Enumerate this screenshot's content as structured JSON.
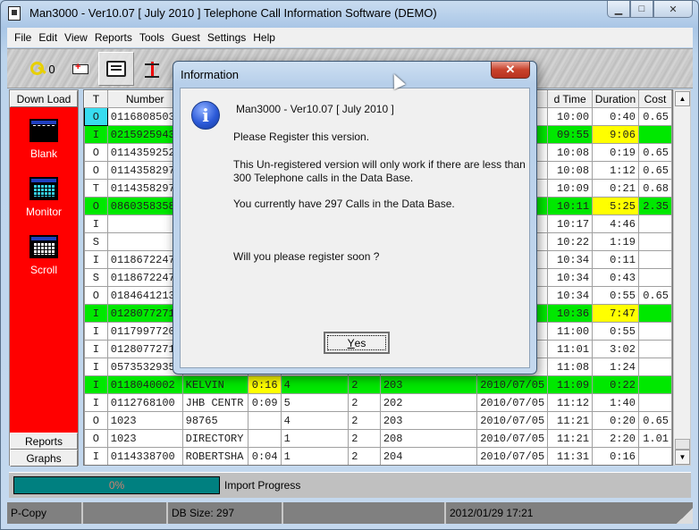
{
  "window": {
    "title": "Man3000  -  Ver10.07 [ July 2010 ]   Telephone Call Information Software (DEMO)",
    "controls": {
      "minimize": "▁",
      "maximize": "□",
      "close": "✕"
    }
  },
  "menu": [
    "File",
    "Edit",
    "View",
    "Reports",
    "Tools",
    "Guest",
    "Settings",
    "Help"
  ],
  "toolbar": {
    "key_count": "0",
    "buttons": [
      "key-icon",
      "ambulance-icon",
      "printer-icon",
      "network-icon"
    ]
  },
  "left_panel": {
    "download_label": "Down Load",
    "tools": [
      {
        "label": "Blank",
        "icon": "blank-grid-icon"
      },
      {
        "label": "Monitor",
        "icon": "monitor-grid-icon"
      },
      {
        "label": "Scroll",
        "icon": "scroll-grid-icon"
      }
    ],
    "reports_label": "Reports",
    "graphs_label": "Graphs"
  },
  "table": {
    "headers": [
      "T",
      "Number",
      "",
      "",
      "",
      "",
      "",
      "",
      "d Time",
      "Duration",
      "Cost"
    ],
    "rows": [
      {
        "t": "O",
        "number": "0116808503",
        "name": "",
        "dur": "",
        "c4": "",
        "c5": "",
        "ext": "",
        "date": "",
        "time": "10:00",
        "duration": "0:40",
        "cost": "0.65",
        "green": false,
        "t_cyan": true
      },
      {
        "t": "I",
        "number": "0215925943",
        "name": "",
        "dur": "",
        "c4": "",
        "c5": "",
        "ext": "",
        "date": "",
        "time": "09:55",
        "duration": "9:06",
        "cost": "",
        "green": true,
        "dur_yellow": true
      },
      {
        "t": "O",
        "number": "0114359252",
        "name": "",
        "dur": "",
        "c4": "",
        "c5": "",
        "ext": "",
        "date": "",
        "time": "10:08",
        "duration": "0:19",
        "cost": "0.65",
        "green": false
      },
      {
        "t": "O",
        "number": "0114358297",
        "name": "",
        "dur": "",
        "c4": "",
        "c5": "",
        "ext": "",
        "date": "",
        "time": "10:08",
        "duration": "1:12",
        "cost": "0.65",
        "green": false
      },
      {
        "t": "T",
        "number": "0114358297",
        "name": "",
        "dur": "",
        "c4": "",
        "c5": "",
        "ext": "",
        "date": "",
        "time": "10:09",
        "duration": "0:21",
        "cost": "0.68",
        "green": false
      },
      {
        "t": "O",
        "number": "0860358358",
        "name": "",
        "dur": "",
        "c4": "",
        "c5": "",
        "ext": "",
        "date": "",
        "time": "10:11",
        "duration": "5:25",
        "cost": "2.35",
        "green": true,
        "dur_yellow": true
      },
      {
        "t": "I",
        "number": "",
        "name": "",
        "dur": "",
        "c4": "",
        "c5": "",
        "ext": "",
        "date": "",
        "time": "10:17",
        "duration": "4:46",
        "cost": "",
        "green": false
      },
      {
        "t": "S",
        "number": "",
        "name": "",
        "dur": "",
        "c4": "",
        "c5": "",
        "ext": "",
        "date": "",
        "time": "10:22",
        "duration": "1:19",
        "cost": "",
        "green": false
      },
      {
        "t": "I",
        "number": "0118672247",
        "name": "",
        "dur": "",
        "c4": "",
        "c5": "",
        "ext": "",
        "date": "",
        "time": "10:34",
        "duration": "0:11",
        "cost": "",
        "green": false
      },
      {
        "t": "S",
        "number": "0118672247",
        "name": "",
        "dur": "",
        "c4": "",
        "c5": "",
        "ext": "",
        "date": "",
        "time": "10:34",
        "duration": "0:43",
        "cost": "",
        "green": false
      },
      {
        "t": "O",
        "number": "0184641213",
        "name": "",
        "dur": "",
        "c4": "",
        "c5": "",
        "ext": "",
        "date": "",
        "time": "10:34",
        "duration": "0:55",
        "cost": "0.65",
        "green": false
      },
      {
        "t": "I",
        "number": "0128077271",
        "name": "",
        "dur": "",
        "c4": "",
        "c5": "",
        "ext": "",
        "date": "",
        "time": "10:36",
        "duration": "7:47",
        "cost": "",
        "green": true,
        "dur_yellow": true
      },
      {
        "t": "I",
        "number": "0117997720",
        "name": "",
        "dur": "",
        "c4": "",
        "c5": "",
        "ext": "",
        "date": "",
        "time": "11:00",
        "duration": "0:55",
        "cost": "",
        "green": false
      },
      {
        "t": "I",
        "number": "0128077271",
        "name": "",
        "dur": "",
        "c4": "",
        "c5": "",
        "ext": "",
        "date": "",
        "time": "11:01",
        "duration": "3:02",
        "cost": "",
        "green": false
      },
      {
        "t": "I",
        "number": "0573532935",
        "name": "",
        "dur": "",
        "c4": "",
        "c5": "",
        "ext": "",
        "date": "",
        "time": "11:08",
        "duration": "1:24",
        "cost": "",
        "green": false
      },
      {
        "t": "I",
        "number": "0118040002",
        "name": "KELVIN",
        "dur": "0:16",
        "c4": "4",
        "c5": "2",
        "ext": "203",
        "date": "2010/07/05",
        "time": "11:09",
        "duration": "0:22",
        "cost": "",
        "green": true,
        "ring_yellow": true
      },
      {
        "t": "I",
        "number": "0112768100",
        "name": "JHB CENTR",
        "dur": "0:09",
        "c4": "5",
        "c5": "2",
        "ext": "202",
        "date": "2010/07/05",
        "time": "11:12",
        "duration": "1:40",
        "cost": "",
        "green": false
      },
      {
        "t": "O",
        "number": "1023",
        "name": "98765",
        "dur": "",
        "c4": "4",
        "c5": "2",
        "ext": "203",
        "date": "2010/07/05",
        "time": "11:21",
        "duration": "0:20",
        "cost": "0.65",
        "green": false
      },
      {
        "t": "O",
        "number": "1023",
        "name": "DIRECTORY",
        "dur": "",
        "c4": "1",
        "c5": "2",
        "ext": "208",
        "date": "2010/07/05",
        "time": "11:21",
        "duration": "2:20",
        "cost": "1.01",
        "green": false
      },
      {
        "t": "I",
        "number": "0114338700",
        "name": "ROBERTSHA",
        "dur": "0:04",
        "c4": "1",
        "c5": "2",
        "ext": "204",
        "date": "2010/07/05",
        "time": "11:31",
        "duration": "0:16",
        "cost": "",
        "green": false
      }
    ]
  },
  "progress": {
    "percent": 0,
    "text": "0%",
    "label": "Import Progress"
  },
  "statusbar": {
    "panels": [
      "P-Copy",
      "",
      "DB Size: 297",
      "",
      "2012/01/29  17:21"
    ]
  },
  "dialog": {
    "title": "Information",
    "close": "✕",
    "lines": [
      "Man3000  -  Ver10.07 [ July 2010 ]",
      "Please Register this version.",
      "This Un-registered version will only work if there are less than",
      "300 Telephone calls in the Data Base.",
      "You currently have 297 Calls in the Data Base.",
      "Will you please register soon ?"
    ],
    "yes_button": {
      "accel": "Y",
      "rest": "es"
    }
  },
  "colors": {
    "row_highlight": "#00e800",
    "duration_highlight": "#ffff00",
    "selected_type": "#38dcf0",
    "panel_red": "#ff0000",
    "progress_teal": "#008080"
  }
}
